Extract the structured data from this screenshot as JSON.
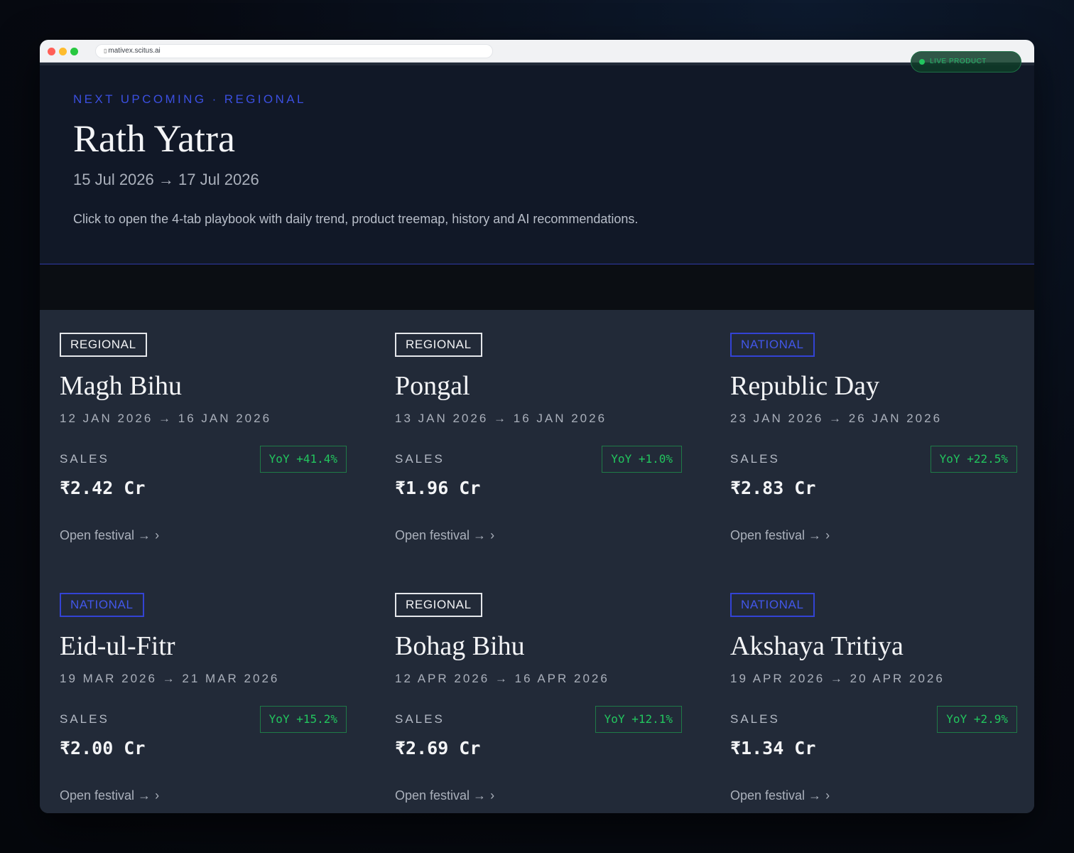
{
  "browser": {
    "url": "mativex.scitus.ai",
    "lock_icon": "lock-icon",
    "badge": "LIVE PRODUCT"
  },
  "hero": {
    "eyebrow": "NEXT UPCOMING · REGIONAL",
    "title": "Rath Yatra",
    "dates": "15 Jul 2026 → 17 Jul 2026",
    "description": "Click to open the 4-tab playbook with daily trend, product treemap, history and AI recommendations."
  },
  "colors": {
    "accent_blue": "#3b4fe0",
    "positive_green": "#22c55e",
    "card_bg": "#222a38",
    "hero_bg": "#111827"
  },
  "festivals": [
    {
      "tag": "REGIONAL",
      "name": "Magh Bihu",
      "range": "12 JAN 2026 → 16 JAN 2026",
      "sales_label": "SALES",
      "yoy": "YoY +41.4%",
      "value": "₹2.42 Cr",
      "link": "Open festival →",
      "chevron": "›"
    },
    {
      "tag": "REGIONAL",
      "name": "Pongal",
      "range": "13 JAN 2026 → 16 JAN 2026",
      "sales_label": "SALES",
      "yoy": "YoY +1.0%",
      "value": "₹1.96 Cr",
      "link": "Open festival →",
      "chevron": "›"
    },
    {
      "tag": "NATIONAL",
      "name": "Republic Day",
      "range": "23 JAN 2026 → 26 JAN 2026",
      "sales_label": "SALES",
      "yoy": "YoY +22.5%",
      "value": "₹2.83 Cr",
      "link": "Open festival →",
      "chevron": "›"
    },
    {
      "tag": "NATIONAL",
      "name": "Eid-ul-Fitr",
      "range": "19 MAR 2026 → 21 MAR 2026",
      "sales_label": "SALES",
      "yoy": "YoY +15.2%",
      "value": "₹2.00 Cr",
      "link": "Open festival →",
      "chevron": "›"
    },
    {
      "tag": "REGIONAL",
      "name": "Bohag Bihu",
      "range": "12 APR 2026 → 16 APR 2026",
      "sales_label": "SALES",
      "yoy": "YoY +12.1%",
      "value": "₹2.69 Cr",
      "link": "Open festival →",
      "chevron": "›"
    },
    {
      "tag": "NATIONAL",
      "name": "Akshaya Tritiya",
      "range": "19 APR 2026 → 20 APR 2026",
      "sales_label": "SALES",
      "yoy": "YoY +2.9%",
      "value": "₹1.34 Cr",
      "link": "Open festival →",
      "chevron": "›"
    }
  ]
}
